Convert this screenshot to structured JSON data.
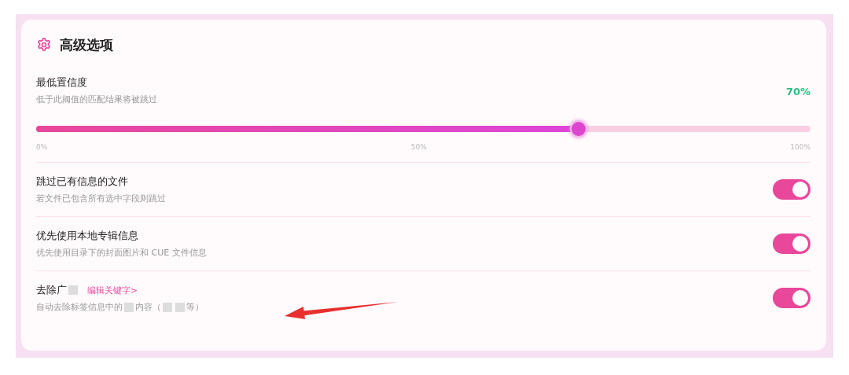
{
  "panel": {
    "title": "高级选项"
  },
  "confidence": {
    "label": "最低置信度",
    "description": "低于此阈值的匹配结果将被跳过",
    "reading": "70%",
    "level": 0.7,
    "ticks": [
      "0%",
      "50%",
      "100%"
    ]
  },
  "options": [
    {
      "title": [
        {
          "kind": "text",
          "text": "跳过已有信息的文件"
        }
      ],
      "description": [
        {
          "kind": "text",
          "text": "若文件已包含所有选中字段则跳过"
        }
      ],
      "on": true
    },
    {
      "title": [
        {
          "kind": "text",
          "text": "优先使用本地专辑信息"
        }
      ],
      "description": [
        {
          "kind": "text",
          "text": "优先使用目录下的封面图片和 CUE 文件信息"
        }
      ],
      "on": true
    },
    {
      "title": [
        {
          "kind": "text",
          "text": "去除广"
        },
        {
          "kind": "redacted"
        }
      ],
      "link": "编辑关键字>",
      "description": [
        {
          "kind": "text",
          "text": "自动去除标签信息中的"
        },
        {
          "kind": "redacted"
        },
        {
          "kind": "text",
          "text": "内容（"
        },
        {
          "kind": "redacted"
        },
        {
          "kind": "redacted"
        },
        {
          "kind": "text",
          "text": "等）"
        }
      ],
      "on": true
    }
  ],
  "annotation": {
    "kind": "arrow"
  }
}
